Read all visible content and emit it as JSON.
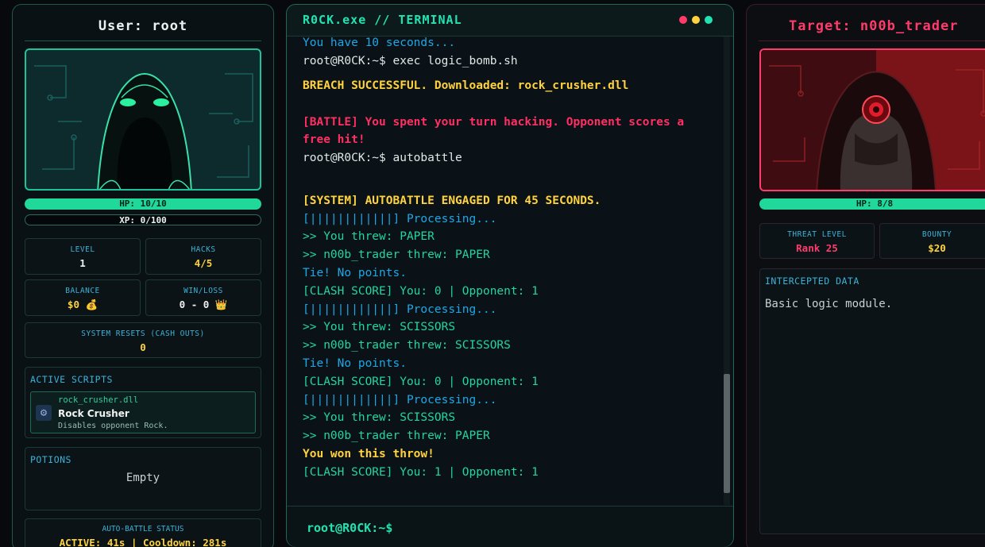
{
  "left": {
    "title": "User: root",
    "hp": "HP: 10/10",
    "hp_fraction": 1.0,
    "xp": "XP: 0/100",
    "xp_fraction": 0.0,
    "stats": {
      "level_label": "LEVEL",
      "level_value": "1",
      "hacks_label": "HACKS",
      "hacks_value": "4/5",
      "balance_label": "BALANCE",
      "balance_value": "$0 💰",
      "winloss_label": "WIN/LOSS",
      "winloss_value": "0 - 0 👑",
      "resets_label": "SYSTEM RESETS (CASH OUTS)",
      "resets_value": "0"
    },
    "scripts": {
      "header": "ACTIVE SCRIPTS",
      "file": "rock_crusher.dll",
      "name": "Rock Crusher",
      "desc": "Disables opponent Rock."
    },
    "potions": {
      "header": "POTIONS",
      "value": "Empty"
    },
    "autobattle": {
      "label": "AUTO-BATTLE STATUS",
      "value": "ACTIVE: 41s | Cooldown: 281s"
    }
  },
  "terminal": {
    "title": "R0CK.exe  // TERMINAL",
    "prompt": "root@R0CK:~$",
    "lines": [
      {
        "text": "You have 10 seconds...",
        "style": "blue"
      },
      {
        "text": "root@R0CK:~$ exec logic_bomb.sh",
        "style": "white"
      },
      {
        "text": "BREACH SUCCESSFUL. Downloaded: rock_crusher.dll",
        "style": "yellow"
      },
      {
        "text": "[BATTLE] You spent your turn hacking. Opponent scores a",
        "style": "red"
      },
      {
        "text": "free hit!",
        "style": "red"
      },
      {
        "text": "root@R0CK:~$ autobattle",
        "style": "white"
      },
      {
        "text": "[SYSTEM] AUTOBATTLE ENGAGED FOR 45 SECONDS.",
        "style": "yellow"
      },
      {
        "text": "[||||||||||||] Processing...",
        "style": "blue"
      },
      {
        "text": ">> You threw: PAPER",
        "style": "green"
      },
      {
        "text": ">> n00b_trader threw: PAPER",
        "style": "green"
      },
      {
        "text": "Tie! No points.",
        "style": "blue"
      },
      {
        "text": "[CLASH SCORE] You: 0 | Opponent: 1",
        "style": "green"
      },
      {
        "text": "[||||||||||||] Processing...",
        "style": "blue"
      },
      {
        "text": ">> You threw: SCISSORS",
        "style": "green"
      },
      {
        "text": ">> n00b_trader threw: SCISSORS",
        "style": "green"
      },
      {
        "text": "Tie! No points.",
        "style": "blue"
      },
      {
        "text": "[CLASH SCORE] You: 0 | Opponent: 1",
        "style": "green"
      },
      {
        "text": "[||||||||||||] Processing...",
        "style": "blue"
      },
      {
        "text": ">> You threw: SCISSORS",
        "style": "green"
      },
      {
        "text": ">> n00b_trader threw: PAPER",
        "style": "green"
      },
      {
        "text": "You won this throw!",
        "style": "yellow"
      },
      {
        "text": "[CLASH SCORE] You: 1 | Opponent: 1",
        "style": "green"
      }
    ]
  },
  "right": {
    "title": "Target: n00b_trader",
    "hp": "HP: 8/8",
    "hp_fraction": 1.0,
    "threat_label": "THREAT LEVEL",
    "threat_value": "Rank 25",
    "bounty_label": "BOUNTY",
    "bounty_value": "$20",
    "intercept_header": "INTERCEPTED DATA",
    "intercept_text": "Basic logic module."
  },
  "colors": {
    "accent": "#22e3b0",
    "danger": "#ff3b6b",
    "warning": "#ffd23f",
    "info": "#1da7e6"
  }
}
